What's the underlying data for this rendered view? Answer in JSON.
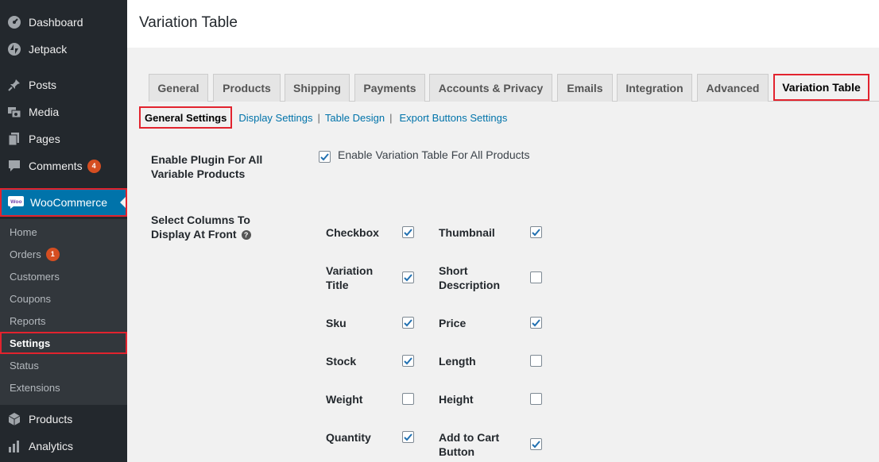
{
  "sidebar": {
    "menu": [
      {
        "label": "Dashboard",
        "icon": "dashboard-icon"
      },
      {
        "label": "Jetpack",
        "icon": "jetpack-icon"
      },
      {
        "label": "Posts",
        "icon": "pin-icon"
      },
      {
        "label": "Media",
        "icon": "media-icon"
      },
      {
        "label": "Pages",
        "icon": "pages-icon"
      },
      {
        "label": "Comments",
        "icon": "comment-icon",
        "badge": "4"
      },
      {
        "label": "WooCommerce",
        "icon": "woo-icon"
      },
      {
        "label": "Products",
        "icon": "box-icon"
      },
      {
        "label": "Analytics",
        "icon": "bar-chart-icon"
      }
    ],
    "submenu": [
      {
        "label": "Home"
      },
      {
        "label": "Orders",
        "badge": "1"
      },
      {
        "label": "Customers"
      },
      {
        "label": "Coupons"
      },
      {
        "label": "Reports"
      },
      {
        "label": "Settings"
      },
      {
        "label": "Status"
      },
      {
        "label": "Extensions"
      }
    ],
    "accent": "#0073aa",
    "highlight": "#e2232e"
  },
  "header": {
    "title": "Variation Table"
  },
  "tabs": [
    {
      "label": "General"
    },
    {
      "label": "Products"
    },
    {
      "label": "Shipping"
    },
    {
      "label": "Payments"
    },
    {
      "label": "Accounts & Privacy"
    },
    {
      "label": "Emails"
    },
    {
      "label": "Integration"
    },
    {
      "label": "Advanced"
    },
    {
      "label": "Variation Table"
    }
  ],
  "subnav": {
    "current": "General Settings",
    "links": [
      "Display Settings",
      "Table Design",
      "Export Buttons Settings"
    ],
    "separator": "|"
  },
  "form": {
    "enable_plugin": {
      "label_line1": "Enable Plugin For All",
      "label_line2": "Variable Products",
      "checkbox_label": "Enable Variation Table For All Products",
      "checked": true
    },
    "columns": {
      "label_line1": "Select Columns To",
      "label_line2": "Display At Front",
      "help_icon": "help-icon",
      "items": [
        {
          "line1": "Checkbox",
          "line2": "",
          "checked": true
        },
        {
          "line1": "Thumbnail",
          "line2": "",
          "checked": true
        },
        {
          "line1": "Variation",
          "line2": "Title",
          "checked": true
        },
        {
          "line1": "Short",
          "line2": "Description",
          "checked": false
        },
        {
          "line1": "Sku",
          "line2": "",
          "checked": true
        },
        {
          "line1": "Price",
          "line2": "",
          "checked": true
        },
        {
          "line1": "Stock",
          "line2": "",
          "checked": true
        },
        {
          "line1": "Length",
          "line2": "",
          "checked": false
        },
        {
          "line1": "Weight",
          "line2": "",
          "checked": false
        },
        {
          "line1": "Height",
          "line2": "",
          "checked": false
        },
        {
          "line1": "Quantity",
          "line2": "",
          "checked": true
        },
        {
          "line1": "Add to Cart",
          "line2": "Button",
          "checked": true
        }
      ]
    }
  }
}
